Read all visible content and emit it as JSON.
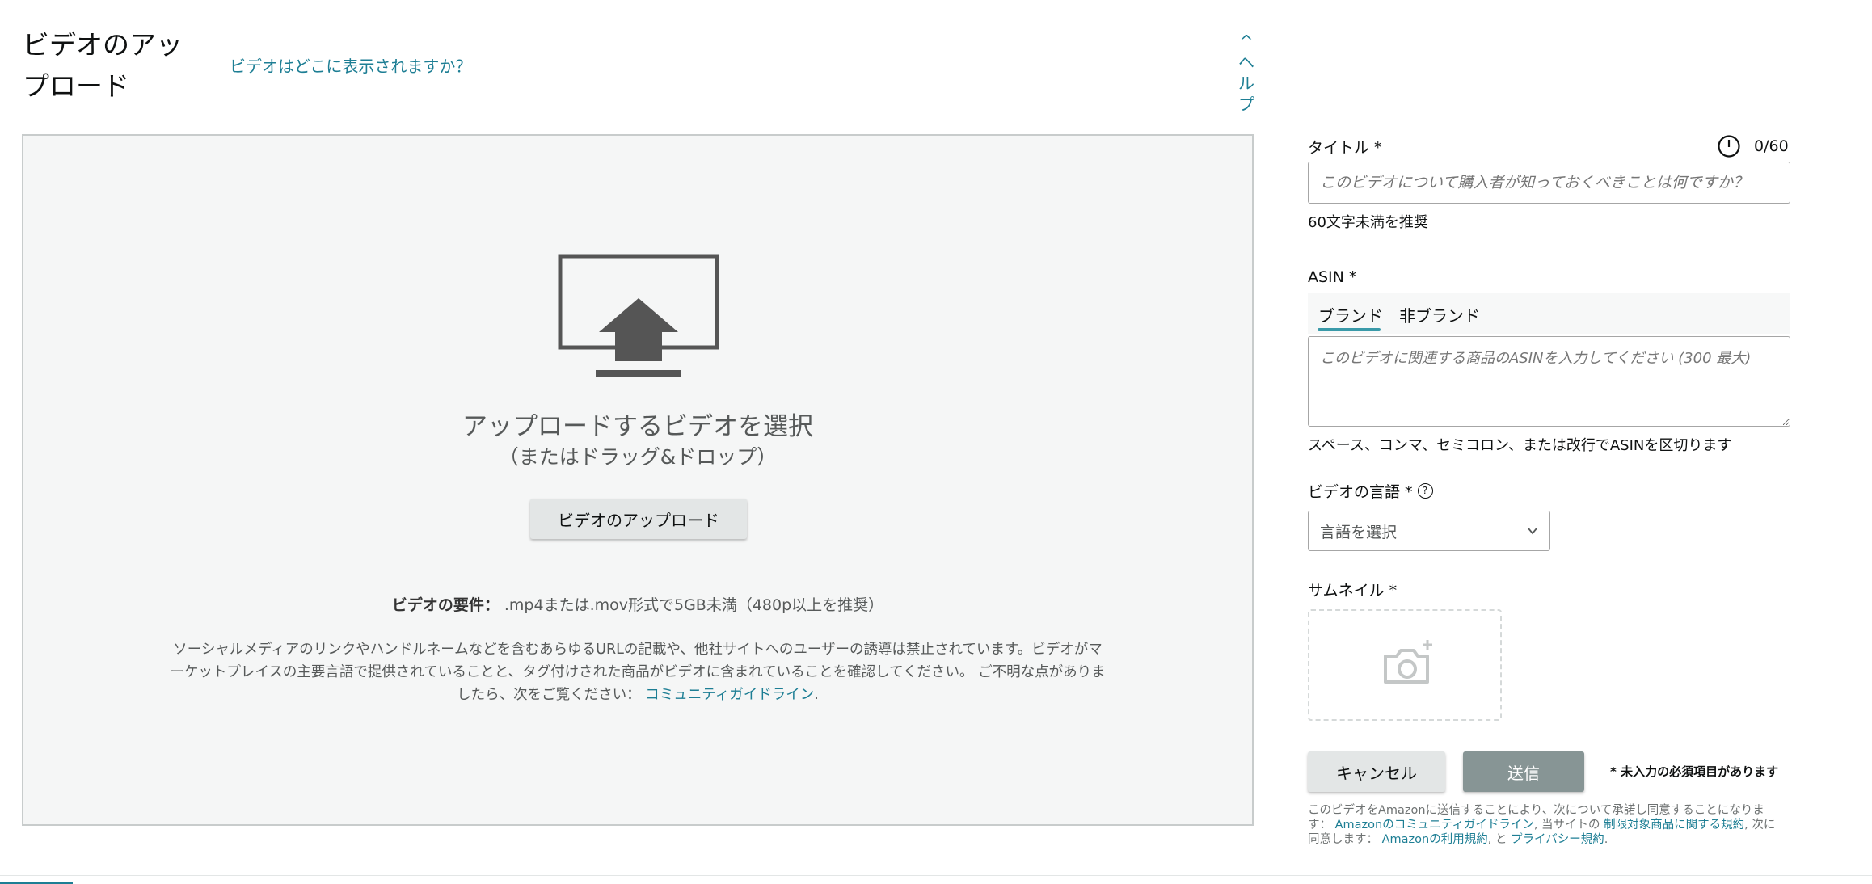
{
  "header": {
    "title": "ビデオのアップロード",
    "where_link": "ビデオはどこに表示されますか？",
    "help_chevron": "^",
    "help_chars": [
      "ヘ",
      "ル",
      "プ"
    ]
  },
  "dropzone": {
    "heading": "アップロードするビデオを選択",
    "subheading": "（またはドラッグ&ドロップ）",
    "upload_button": "ビデオのアップロード",
    "requirements_label": "ビデオの要件：",
    "requirements_text": ".mp4または.mov形式で5GB未満（480p以上を推奨）",
    "policy_text": "ソーシャルメディアのリンクやハンドルネームなどを含むあらゆるURLの記載や、他社サイトへのユーザーの誘導は禁止されています。ビデオがマーケットプレイスの主要言語で提供されていることと、タグ付けされた商品がビデオに含まれていることを確認してください。 ご不明な点がありましたら、次をご覧ください：",
    "policy_link": "コミュニティガイドライン",
    "policy_end": ".",
    "icon": "upload-monitor-icon"
  },
  "form": {
    "title_label": "タイトル *",
    "title_counter": "0/60",
    "title_placeholder": "このビデオについて購入者が知っておくべきことは何ですか？",
    "title_value": "",
    "title_hint": "60文字未満を推奨",
    "asin_label": "ASIN *",
    "asin_tabs": [
      {
        "label": "ブランド",
        "selected": true
      },
      {
        "label": "非ブランド",
        "selected": false
      }
    ],
    "asin_placeholder": "このビデオに関連する商品のASINを入力してください (300 最大)",
    "asin_value": "",
    "asin_hint": "スペース、コンマ、セミコロン、または改行でASINを区切ります",
    "language_label": "ビデオの言語 *",
    "language_help": "?",
    "language_selected": "言語を選択",
    "thumbnail_label": "サムネイル *",
    "cancel_button": "キャンセル",
    "submit_button": "送信",
    "required_note": "* 未入力の必須項目があります",
    "legal": {
      "part1": "このビデオをAmazonに送信することにより、次について承諾し同意することになります：",
      "link1": "Amazonのコミュニティガイドライン",
      "part2": ", 当サイトの",
      "link2": "制限対象商品に関する規約",
      "part3": ", 次に同意します：",
      "link3": "Amazonの利用規約",
      "part4": ", と",
      "link4": "プライバシー規約",
      "part5": "."
    }
  },
  "colors": {
    "link": "#1d7e94",
    "tab_underline": "#3a9aa9",
    "submit_disabled": "#879595",
    "button_secondary": "#e3e6e6",
    "dropzone_bg": "#f5f6f6"
  }
}
